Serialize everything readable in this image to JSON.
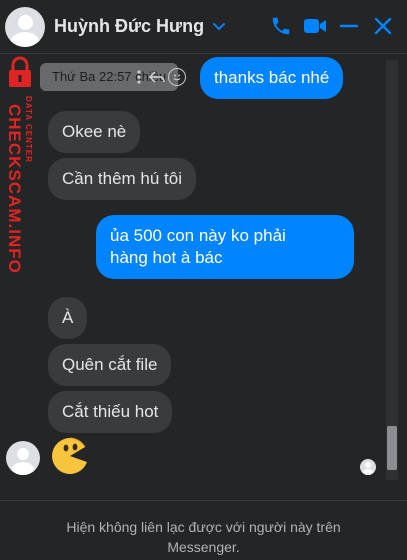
{
  "header": {
    "contact_name": "Huỳnh Đức Hưng",
    "icons": [
      "avatar",
      "chevron-down-icon",
      "phone-icon",
      "video-icon",
      "minimize-icon",
      "close-icon"
    ],
    "accent_color": "#0084ff"
  },
  "messages": {
    "tooltip": "Thứ Ba 22:57 chiều",
    "items": [
      {
        "side": "out",
        "text": "thanks bác nhé"
      },
      {
        "side": "in",
        "text": "Okee nè"
      },
      {
        "side": "in",
        "text": "Cần thêm hú tôi"
      },
      {
        "side": "out",
        "lines": [
          "ủa 500 con này ko phải",
          "hàng hot à bác"
        ]
      },
      {
        "side": "in",
        "text": "À"
      },
      {
        "side": "in",
        "text": "Quên cắt file"
      },
      {
        "side": "in",
        "text": "Cắt thiếu hot"
      },
      {
        "side": "in",
        "sticker": "pacman-sticker"
      }
    ]
  },
  "footer": {
    "notice_line1": "Hiện không liên lạc được với người này trên",
    "notice_line2": "Messenger."
  },
  "watermark": {
    "text": "CHECKSCAM.INFO",
    "subtext": "DATA CENTER"
  }
}
